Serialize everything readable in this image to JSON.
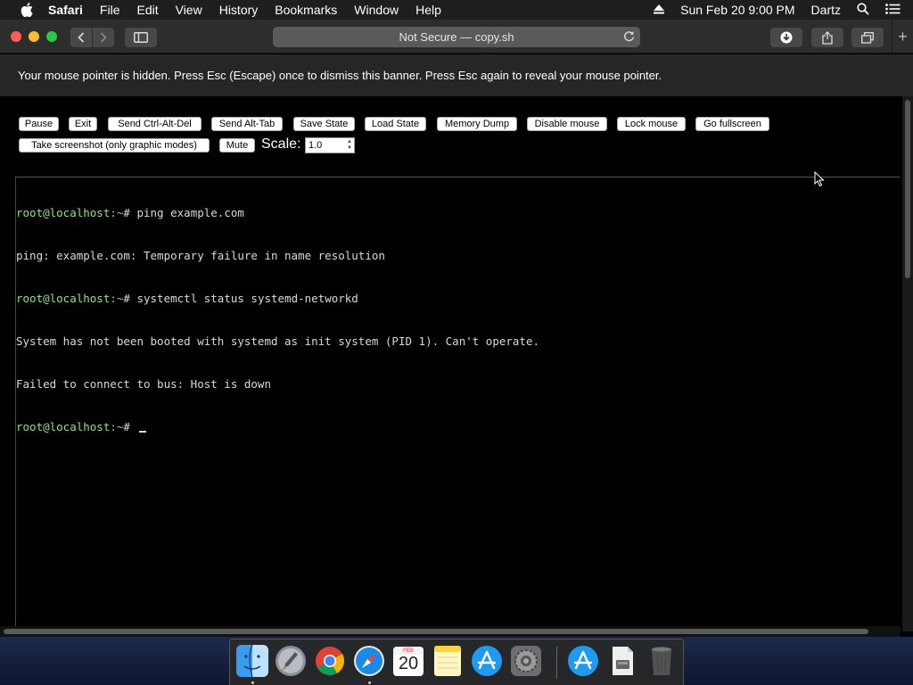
{
  "menubar": {
    "app": "Safari",
    "items": [
      "File",
      "Edit",
      "View",
      "History",
      "Bookmarks",
      "Window",
      "Help"
    ],
    "datetime": "Sun Feb 20  9:00 PM",
    "user": "Dartz"
  },
  "toolbar": {
    "address": "Not Secure — copy.sh"
  },
  "banner": {
    "text": "Your mouse pointer is hidden. Press Esc (Escape) once to dismiss this banner. Press Esc again to reveal your mouse pointer."
  },
  "controls": {
    "pause": "Pause",
    "exit": "Exit",
    "ctrl_alt_del": "Send Ctrl-Alt-Del",
    "alt_tab": "Send Alt-Tab",
    "save_state": "Save State",
    "load_state": "Load State",
    "memory_dump": "Memory Dump",
    "disable_mouse": "Disable mouse",
    "lock_mouse": "Lock mouse",
    "fullscreen": "Go fullscreen",
    "screenshot": "Take screenshot (only graphic modes)",
    "mute": "Mute",
    "scale_label": "Scale:",
    "scale_value": "1.0"
  },
  "terminal": {
    "prompt_user": "root@localhost",
    "prompt_path": ":~",
    "prompt_symbol": "# ",
    "cmd1": "ping example.com",
    "out1": "ping: example.com: Temporary failure in name resolution",
    "cmd2": "systemctl status systemd-networkd",
    "out2": "System has not been booted with systemd as init system (PID 1). Can't operate.",
    "out3": "Failed to connect to bus: Host is down"
  },
  "dock": {
    "calendar_month": "FEB",
    "calendar_day": "20"
  },
  "colors": {
    "prompt_user": "#8ee585",
    "terminal_text": "#d9d9d9",
    "banner_bg": "#262626"
  }
}
